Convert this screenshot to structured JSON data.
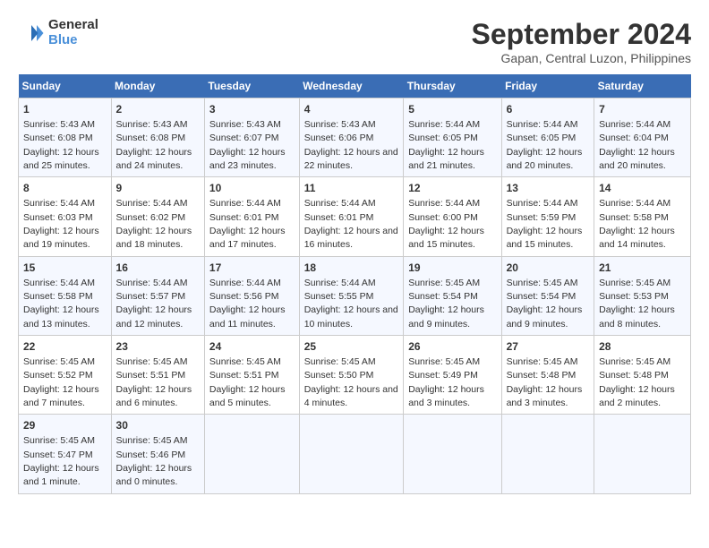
{
  "header": {
    "logo_line1": "General",
    "logo_line2": "Blue",
    "main_title": "September 2024",
    "subtitle": "Gapan, Central Luzon, Philippines"
  },
  "days_of_week": [
    "Sunday",
    "Monday",
    "Tuesday",
    "Wednesday",
    "Thursday",
    "Friday",
    "Saturday"
  ],
  "weeks": [
    [
      {
        "day": "1",
        "sunrise": "5:43 AM",
        "sunset": "6:08 PM",
        "daylight": "12 hours and 25 minutes."
      },
      {
        "day": "2",
        "sunrise": "5:43 AM",
        "sunset": "6:08 PM",
        "daylight": "12 hours and 24 minutes."
      },
      {
        "day": "3",
        "sunrise": "5:43 AM",
        "sunset": "6:07 PM",
        "daylight": "12 hours and 23 minutes."
      },
      {
        "day": "4",
        "sunrise": "5:43 AM",
        "sunset": "6:06 PM",
        "daylight": "12 hours and 22 minutes."
      },
      {
        "day": "5",
        "sunrise": "5:44 AM",
        "sunset": "6:05 PM",
        "daylight": "12 hours and 21 minutes."
      },
      {
        "day": "6",
        "sunrise": "5:44 AM",
        "sunset": "6:05 PM",
        "daylight": "12 hours and 20 minutes."
      },
      {
        "day": "7",
        "sunrise": "5:44 AM",
        "sunset": "6:04 PM",
        "daylight": "12 hours and 20 minutes."
      }
    ],
    [
      {
        "day": "8",
        "sunrise": "5:44 AM",
        "sunset": "6:03 PM",
        "daylight": "12 hours and 19 minutes."
      },
      {
        "day": "9",
        "sunrise": "5:44 AM",
        "sunset": "6:02 PM",
        "daylight": "12 hours and 18 minutes."
      },
      {
        "day": "10",
        "sunrise": "5:44 AM",
        "sunset": "6:01 PM",
        "daylight": "12 hours and 17 minutes."
      },
      {
        "day": "11",
        "sunrise": "5:44 AM",
        "sunset": "6:01 PM",
        "daylight": "12 hours and 16 minutes."
      },
      {
        "day": "12",
        "sunrise": "5:44 AM",
        "sunset": "6:00 PM",
        "daylight": "12 hours and 15 minutes."
      },
      {
        "day": "13",
        "sunrise": "5:44 AM",
        "sunset": "5:59 PM",
        "daylight": "12 hours and 15 minutes."
      },
      {
        "day": "14",
        "sunrise": "5:44 AM",
        "sunset": "5:58 PM",
        "daylight": "12 hours and 14 minutes."
      }
    ],
    [
      {
        "day": "15",
        "sunrise": "5:44 AM",
        "sunset": "5:58 PM",
        "daylight": "12 hours and 13 minutes."
      },
      {
        "day": "16",
        "sunrise": "5:44 AM",
        "sunset": "5:57 PM",
        "daylight": "12 hours and 12 minutes."
      },
      {
        "day": "17",
        "sunrise": "5:44 AM",
        "sunset": "5:56 PM",
        "daylight": "12 hours and 11 minutes."
      },
      {
        "day": "18",
        "sunrise": "5:44 AM",
        "sunset": "5:55 PM",
        "daylight": "12 hours and 10 minutes."
      },
      {
        "day": "19",
        "sunrise": "5:45 AM",
        "sunset": "5:54 PM",
        "daylight": "12 hours and 9 minutes."
      },
      {
        "day": "20",
        "sunrise": "5:45 AM",
        "sunset": "5:54 PM",
        "daylight": "12 hours and 9 minutes."
      },
      {
        "day": "21",
        "sunrise": "5:45 AM",
        "sunset": "5:53 PM",
        "daylight": "12 hours and 8 minutes."
      }
    ],
    [
      {
        "day": "22",
        "sunrise": "5:45 AM",
        "sunset": "5:52 PM",
        "daylight": "12 hours and 7 minutes."
      },
      {
        "day": "23",
        "sunrise": "5:45 AM",
        "sunset": "5:51 PM",
        "daylight": "12 hours and 6 minutes."
      },
      {
        "day": "24",
        "sunrise": "5:45 AM",
        "sunset": "5:51 PM",
        "daylight": "12 hours and 5 minutes."
      },
      {
        "day": "25",
        "sunrise": "5:45 AM",
        "sunset": "5:50 PM",
        "daylight": "12 hours and 4 minutes."
      },
      {
        "day": "26",
        "sunrise": "5:45 AM",
        "sunset": "5:49 PM",
        "daylight": "12 hours and 3 minutes."
      },
      {
        "day": "27",
        "sunrise": "5:45 AM",
        "sunset": "5:48 PM",
        "daylight": "12 hours and 3 minutes."
      },
      {
        "day": "28",
        "sunrise": "5:45 AM",
        "sunset": "5:48 PM",
        "daylight": "12 hours and 2 minutes."
      }
    ],
    [
      {
        "day": "29",
        "sunrise": "5:45 AM",
        "sunset": "5:47 PM",
        "daylight": "12 hours and 1 minute."
      },
      {
        "day": "30",
        "sunrise": "5:45 AM",
        "sunset": "5:46 PM",
        "daylight": "12 hours and 0 minutes."
      },
      null,
      null,
      null,
      null,
      null
    ]
  ]
}
